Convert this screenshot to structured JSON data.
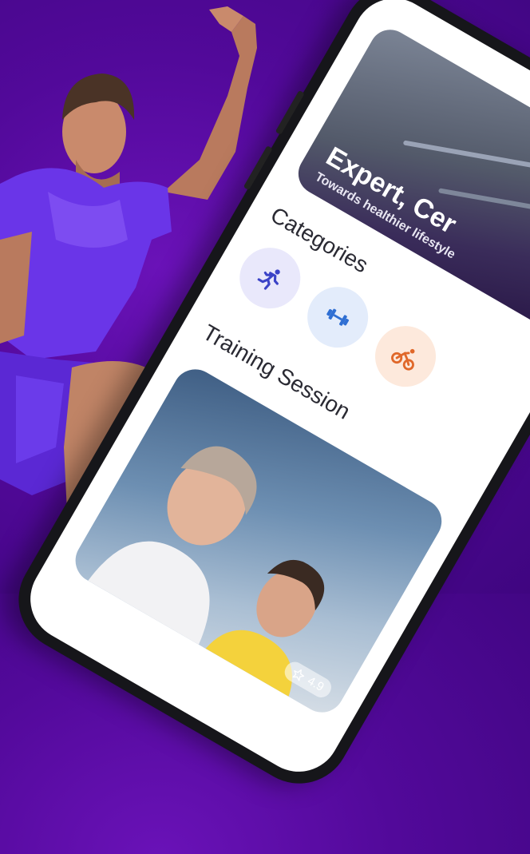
{
  "hero": {
    "title": "Expert, Cer",
    "subtitle": "Towards healthier lifestyle"
  },
  "sections": {
    "categories_title": "Categories",
    "training_title": "Training Session"
  },
  "categories": [
    {
      "icon": "running-icon",
      "bg": "#e9e8fb",
      "color": "#3b43c7"
    },
    {
      "icon": "dumbbell-icon",
      "bg": "#e3ecfb",
      "color": "#2f6fd3"
    },
    {
      "icon": "cycling-icon",
      "bg": "#fde9dc",
      "color": "#e0682a"
    }
  ],
  "training_card": {
    "rating": "4.9"
  },
  "colors": {
    "background": "#52099a",
    "shirt": "#6a35e8",
    "phone_frame": "#16161a"
  }
}
